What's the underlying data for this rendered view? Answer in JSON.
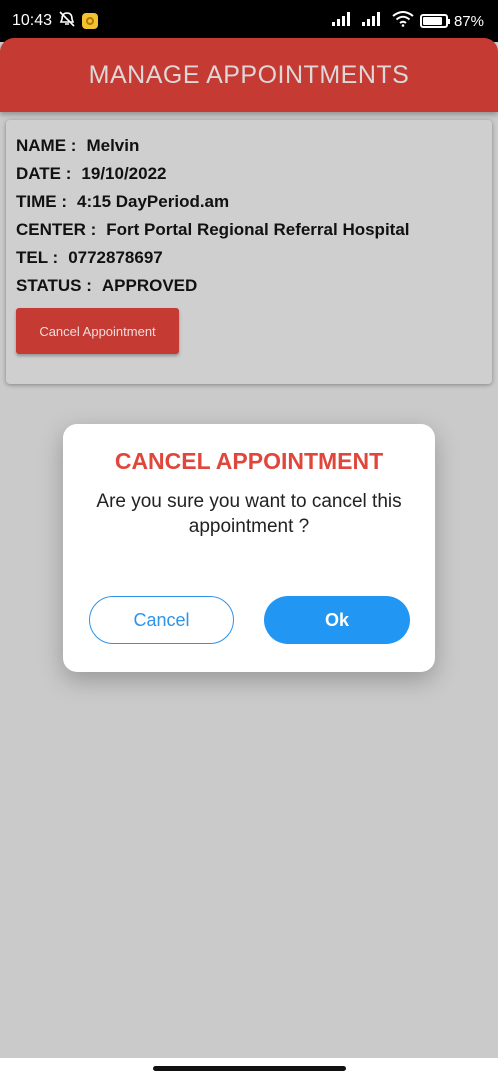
{
  "status_bar": {
    "time": "10:43",
    "battery": "87%"
  },
  "app_bar": {
    "title": "MANAGE APPOINTMENTS"
  },
  "appointment": {
    "name_label": "NAME :",
    "name": "Melvin",
    "date_label": "DATE :",
    "date": "19/10/2022",
    "time_label": "TIME :",
    "time": "4:15 DayPeriod.am",
    "center_label": "CENTER :",
    "center": "Fort Portal Regional Referral Hospital",
    "tel_label": "TEL :",
    "tel": "0772878697",
    "status_label": "STATUS :",
    "status": "APPROVED",
    "cancel_button_label": "Cancel Appointment"
  },
  "dialog": {
    "title": "CANCEL APPOINTMENT",
    "message": "Are you sure you want to cancel this appointment ?",
    "cancel_label": "Cancel",
    "ok_label": "Ok"
  },
  "colors": {
    "primary": "#c53a32",
    "accent": "#2196f3",
    "dialog_title": "#e0473c"
  }
}
